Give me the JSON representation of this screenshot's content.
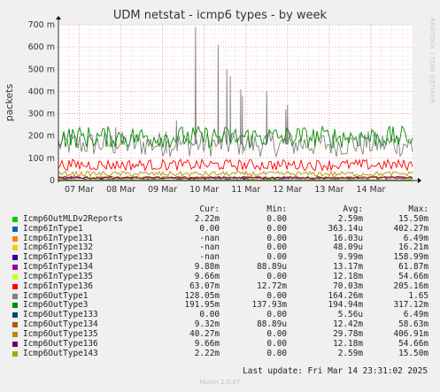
{
  "page": {
    "title": "UDM netstat - icmp6 types - by week",
    "side_label": "RRDTOOL / TOBI OETIKER",
    "last_update": "Last update: Fri Mar 14 23:31:02 2025",
    "footer": "Munin 2.0.67"
  },
  "legend": {
    "headers": [
      "Cur:",
      "Min:",
      "Avg:",
      "Max:"
    ],
    "rows": [
      {
        "name": "Icmp6OutMLDv2Reports",
        "color": "#00cc00",
        "cur": "2.22m",
        "min": "0.00",
        "avg": "2.59m",
        "max": "15.50m"
      },
      {
        "name": "Icmp6InType1",
        "color": "#0066b3",
        "cur": "0.00",
        "min": "0.00",
        "avg": "363.14u",
        "max": "402.27m"
      },
      {
        "name": "Icmp6InType131",
        "color": "#ff8000",
        "cur": "-nan",
        "min": "0.00",
        "avg": "16.03u",
        "max": "6.49m"
      },
      {
        "name": "Icmp6InType132",
        "color": "#ffcc00",
        "cur": "-nan",
        "min": "0.00",
        "avg": "48.09u",
        "max": "16.21m"
      },
      {
        "name": "Icmp6InType133",
        "color": "#330099",
        "cur": "-nan",
        "min": "0.00",
        "avg": "9.99m",
        "max": "158.99m"
      },
      {
        "name": "Icmp6InType134",
        "color": "#990099",
        "cur": "9.88m",
        "min": "88.89u",
        "avg": "13.17m",
        "max": "61.87m"
      },
      {
        "name": "Icmp6InType135",
        "color": "#ccff00",
        "cur": "9.66m",
        "min": "0.00",
        "avg": "12.18m",
        "max": "54.66m"
      },
      {
        "name": "Icmp6InType136",
        "color": "#ff0000",
        "cur": "63.07m",
        "min": "12.72m",
        "avg": "70.03m",
        "max": "205.16m"
      },
      {
        "name": "Icmp6OutType1",
        "color": "#808080",
        "cur": "128.05m",
        "min": "0.00",
        "avg": "164.26m",
        "max": "1.65"
      },
      {
        "name": "Icmp6OutType3",
        "color": "#008f00",
        "cur": "191.95m",
        "min": "137.93m",
        "avg": "194.94m",
        "max": "317.12m"
      },
      {
        "name": "Icmp6OutType133",
        "color": "#00487d",
        "cur": "0.00",
        "min": "0.00",
        "avg": "5.56u",
        "max": "6.49m"
      },
      {
        "name": "Icmp6OutType134",
        "color": "#b35a00",
        "cur": "9.32m",
        "min": "88.89u",
        "avg": "12.42m",
        "max": "58.63m"
      },
      {
        "name": "Icmp6OutType135",
        "color": "#b38f00",
        "cur": "40.27m",
        "min": "0.00",
        "avg": "29.78m",
        "max": "406.91m"
      },
      {
        "name": "Icmp6OutType136",
        "color": "#6b006b",
        "cur": "9.66m",
        "min": "0.00",
        "avg": "12.18m",
        "max": "54.66m"
      },
      {
        "name": "Icmp6OutType143",
        "color": "#8fb300",
        "cur": "2.22m",
        "min": "0.00",
        "avg": "2.59m",
        "max": "15.50m"
      }
    ]
  },
  "chart_data": {
    "type": "line",
    "title": "UDM netstat - icmp6 types - by week",
    "ylabel": "packets",
    "xlabel": "",
    "ylim": [
      0,
      0.7
    ],
    "yticks": [
      {
        "value": 0,
        "label": "0"
      },
      {
        "value": 0.1,
        "label": "100 m"
      },
      {
        "value": 0.2,
        "label": "200 m"
      },
      {
        "value": 0.3,
        "label": "300 m"
      },
      {
        "value": 0.4,
        "label": "400 m"
      },
      {
        "value": 0.5,
        "label": "500 m"
      },
      {
        "value": 0.6,
        "label": "600 m"
      },
      {
        "value": 0.7,
        "label": "700 m"
      }
    ],
    "xlim": [
      "2025-03-06T12:00",
      "2025-03-15T00:00"
    ],
    "xticks": [
      {
        "value": "2025-03-07T00:00",
        "label": "07 Mar"
      },
      {
        "value": "2025-03-08T00:00",
        "label": "08 Mar"
      },
      {
        "value": "2025-03-09T00:00",
        "label": "09 Mar"
      },
      {
        "value": "2025-03-10T00:00",
        "label": "10 Mar"
      },
      {
        "value": "2025-03-11T00:00",
        "label": "11 Mar"
      },
      {
        "value": "2025-03-12T00:00",
        "label": "12 Mar"
      },
      {
        "value": "2025-03-13T00:00",
        "label": "13 Mar"
      },
      {
        "value": "2025-03-14T00:00",
        "label": "14 Mar"
      }
    ],
    "grid": true,
    "series": [
      {
        "name": "Icmp6OutMLDv2Reports",
        "color": "#00cc00",
        "cur": 0.00222,
        "min": 0,
        "avg": 0.00259,
        "max": 0.0155
      },
      {
        "name": "Icmp6InType1",
        "color": "#0066b3",
        "cur": 0,
        "min": 0,
        "avg": 0.000363,
        "max": 0.402
      },
      {
        "name": "Icmp6InType131",
        "color": "#ff8000",
        "cur": null,
        "min": 0,
        "avg": 1.6e-05,
        "max": 0.00649
      },
      {
        "name": "Icmp6InType132",
        "color": "#ffcc00",
        "cur": null,
        "min": 0,
        "avg": 4.8e-05,
        "max": 0.0162
      },
      {
        "name": "Icmp6InType133",
        "color": "#330099",
        "cur": null,
        "min": 0,
        "avg": 0.00999,
        "max": 0.159
      },
      {
        "name": "Icmp6InType134",
        "color": "#990099",
        "cur": 0.00988,
        "min": 8.89e-05,
        "avg": 0.01317,
        "max": 0.0619
      },
      {
        "name": "Icmp6InType135",
        "color": "#ccff00",
        "cur": 0.00966,
        "min": 0,
        "avg": 0.01218,
        "max": 0.0547
      },
      {
        "name": "Icmp6InType136",
        "color": "#ff0000",
        "cur": 0.06307,
        "min": 0.01272,
        "avg": 0.07003,
        "max": 0.205
      },
      {
        "name": "Icmp6OutType1",
        "color": "#808080",
        "cur": 0.128,
        "min": 0,
        "avg": 0.164,
        "max": 1.65
      },
      {
        "name": "Icmp6OutType3",
        "color": "#008f00",
        "cur": 0.192,
        "min": 0.138,
        "avg": 0.195,
        "max": 0.317
      },
      {
        "name": "Icmp6OutType133",
        "color": "#00487d",
        "cur": 0,
        "min": 0,
        "avg": 5.6e-06,
        "max": 0.00649
      },
      {
        "name": "Icmp6OutType134",
        "color": "#b35a00",
        "cur": 0.00932,
        "min": 8.89e-05,
        "avg": 0.01242,
        "max": 0.0586
      },
      {
        "name": "Icmp6OutType135",
        "color": "#b38f00",
        "cur": 0.0403,
        "min": 0,
        "avg": 0.0298,
        "max": 0.407
      },
      {
        "name": "Icmp6OutType136",
        "color": "#6b006b",
        "cur": 0.00966,
        "min": 0,
        "avg": 0.01218,
        "max": 0.0547
      },
      {
        "name": "Icmp6OutType143",
        "color": "#8fb300",
        "cur": 0.00222,
        "min": 0,
        "avg": 0.00259,
        "max": 0.0155
      }
    ],
    "spikes": [
      {
        "series": "Icmp6OutType1",
        "x": "2025-03-09T08:00",
        "y": 0.27
      },
      {
        "series": "Icmp6OutType1",
        "x": "2025-03-09T19:00",
        "y": 0.69
      },
      {
        "series": "Icmp6OutType1",
        "x": "2025-03-10T08:00",
        "y": 0.61
      },
      {
        "series": "Icmp6OutType1",
        "x": "2025-03-10T13:00",
        "y": 0.5
      },
      {
        "series": "Icmp6OutType1",
        "x": "2025-03-10T15:00",
        "y": 0.47
      },
      {
        "series": "Icmp6OutType1",
        "x": "2025-03-10T21:00",
        "y": 0.41
      },
      {
        "series": "Icmp6OutType1",
        "x": "2025-03-10T22:00",
        "y": 0.38
      },
      {
        "series": "Icmp6OutType1",
        "x": "2025-03-11T12:00",
        "y": 0.4
      },
      {
        "series": "Icmp6OutType1",
        "x": "2025-03-11T23:00",
        "y": 0.32
      },
      {
        "series": "Icmp6OutType1",
        "x": "2025-03-12T00:00",
        "y": 0.34
      },
      {
        "series": "Icmp6OutType1",
        "x": "2025-03-09T02:00",
        "y": 0.22
      },
      {
        "series": "Icmp6OutType1",
        "x": "2025-03-07T21:00",
        "y": 0.24
      }
    ]
  }
}
